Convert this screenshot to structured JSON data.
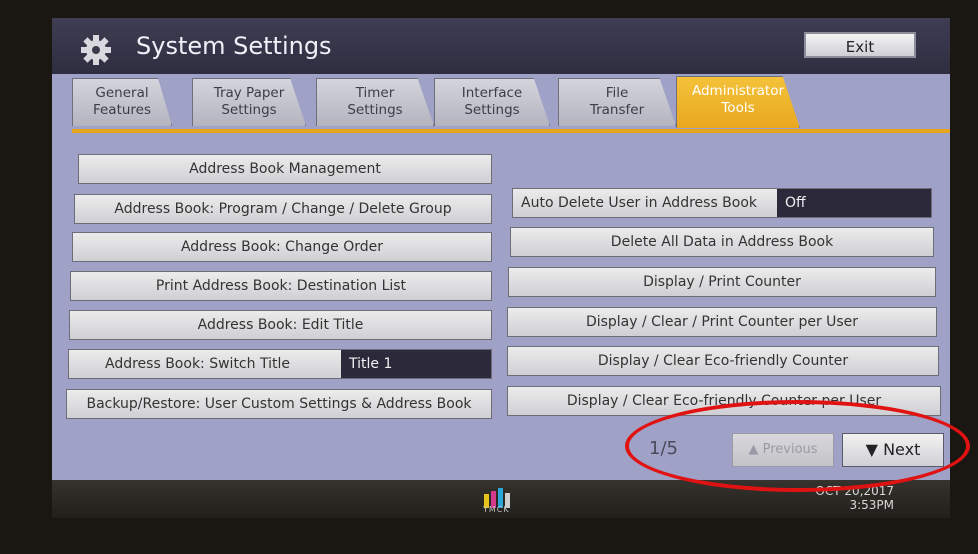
{
  "window": {
    "title": "System Settings",
    "exit_label": "Exit"
  },
  "tabs": [
    {
      "label": "General Features",
      "line1": "General",
      "line2": "Features"
    },
    {
      "label": "Tray Paper Settings",
      "line1": "Tray Paper",
      "line2": "Settings"
    },
    {
      "label": "Timer Settings",
      "line1": "Timer",
      "line2": "Settings"
    },
    {
      "label": "Interface Settings",
      "line1": "Interface",
      "line2": "Settings"
    },
    {
      "label": "File Transfer",
      "line1": "File",
      "line2": "Transfer"
    },
    {
      "label": "Administrator Tools",
      "line1": "Administrator",
      "line2": "Tools",
      "active": true
    }
  ],
  "left_buttons": [
    {
      "label": "Address Book Management"
    },
    {
      "label": "Address Book: Program / Change / Delete Group"
    },
    {
      "label": "Address Book: Change Order"
    },
    {
      "label": "Print Address Book: Destination List"
    },
    {
      "label": "Address Book: Edit Title"
    },
    {
      "label": "Address Book: Switch Title",
      "value": "Title 1"
    },
    {
      "label": "Backup/Restore: User Custom Settings & Address Book"
    }
  ],
  "right_buttons": [
    {
      "label": "Auto Delete User in Address Book",
      "value": "Off"
    },
    {
      "label": "Delete All Data in Address Book"
    },
    {
      "label": "Display / Print Counter"
    },
    {
      "label": "Display / Clear / Print Counter per User"
    },
    {
      "label": "Display / Clear Eco-friendly Counter"
    },
    {
      "label": "Display / Clear Eco-friendly Counter per User"
    }
  ],
  "pagination": {
    "page": "1/5",
    "previous_label": "Previous",
    "next_label": "Next"
  },
  "status": {
    "brand_text": "YMCK",
    "date": "OCT 20,2017",
    "time": "3:53PM"
  },
  "colors": {
    "accent": "#e7a51d",
    "screen_bg": "#9fa1c6",
    "annotation": "#e11212"
  }
}
